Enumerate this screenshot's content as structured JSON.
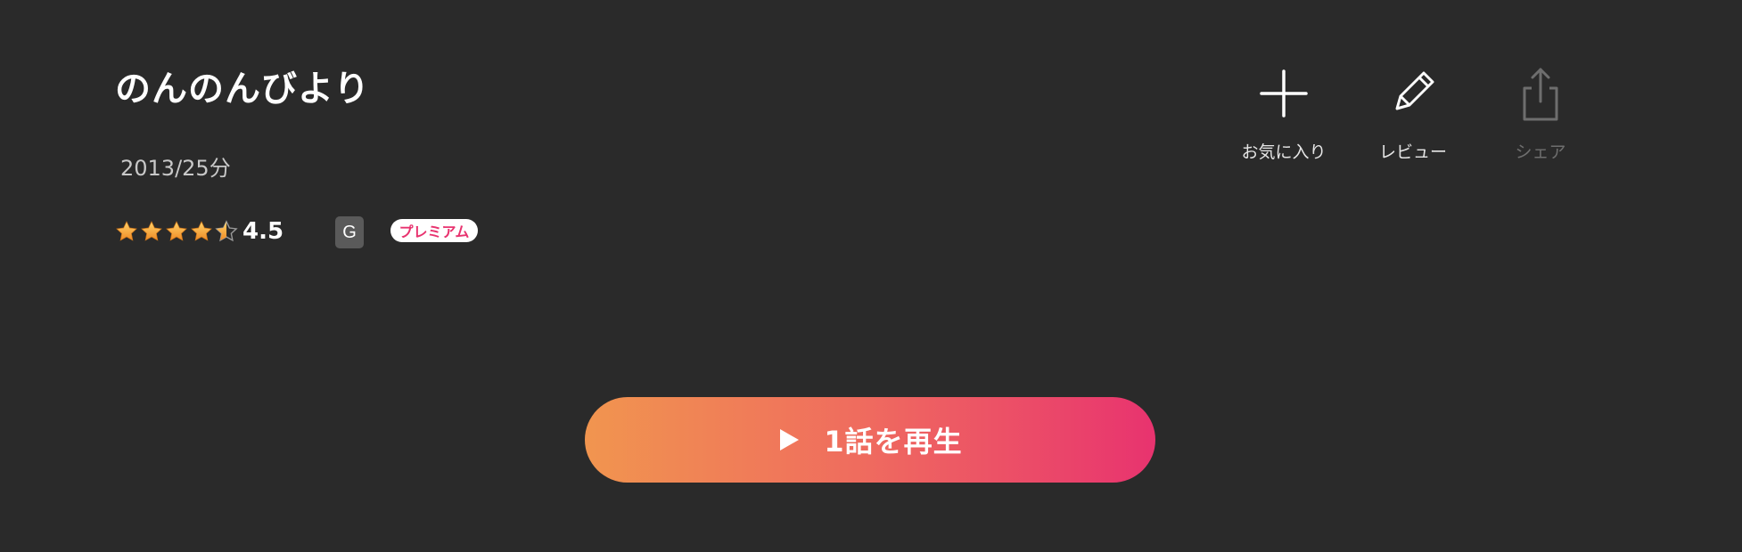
{
  "title": "のんのんびより",
  "meta": "2013/25分",
  "rating": {
    "value": 4.5,
    "label": "4.5",
    "max": 5,
    "star_color": "#f6a623"
  },
  "badges": {
    "age_rating": "G",
    "premium": "プレミアム"
  },
  "actions": {
    "favorite": {
      "label": "お気に入り",
      "icon": "plus-icon"
    },
    "review": {
      "label": "レビュー",
      "icon": "pencil-icon"
    },
    "share": {
      "label": "シェア",
      "icon": "share-icon",
      "disabled": true
    }
  },
  "play_button": {
    "label": "1話を再生",
    "icon": "play-icon",
    "gradient": [
      "#f1954f",
      "#e8336f"
    ]
  },
  "colors": {
    "background": "#2a2a2a",
    "premium_accent": "#e8336f"
  }
}
